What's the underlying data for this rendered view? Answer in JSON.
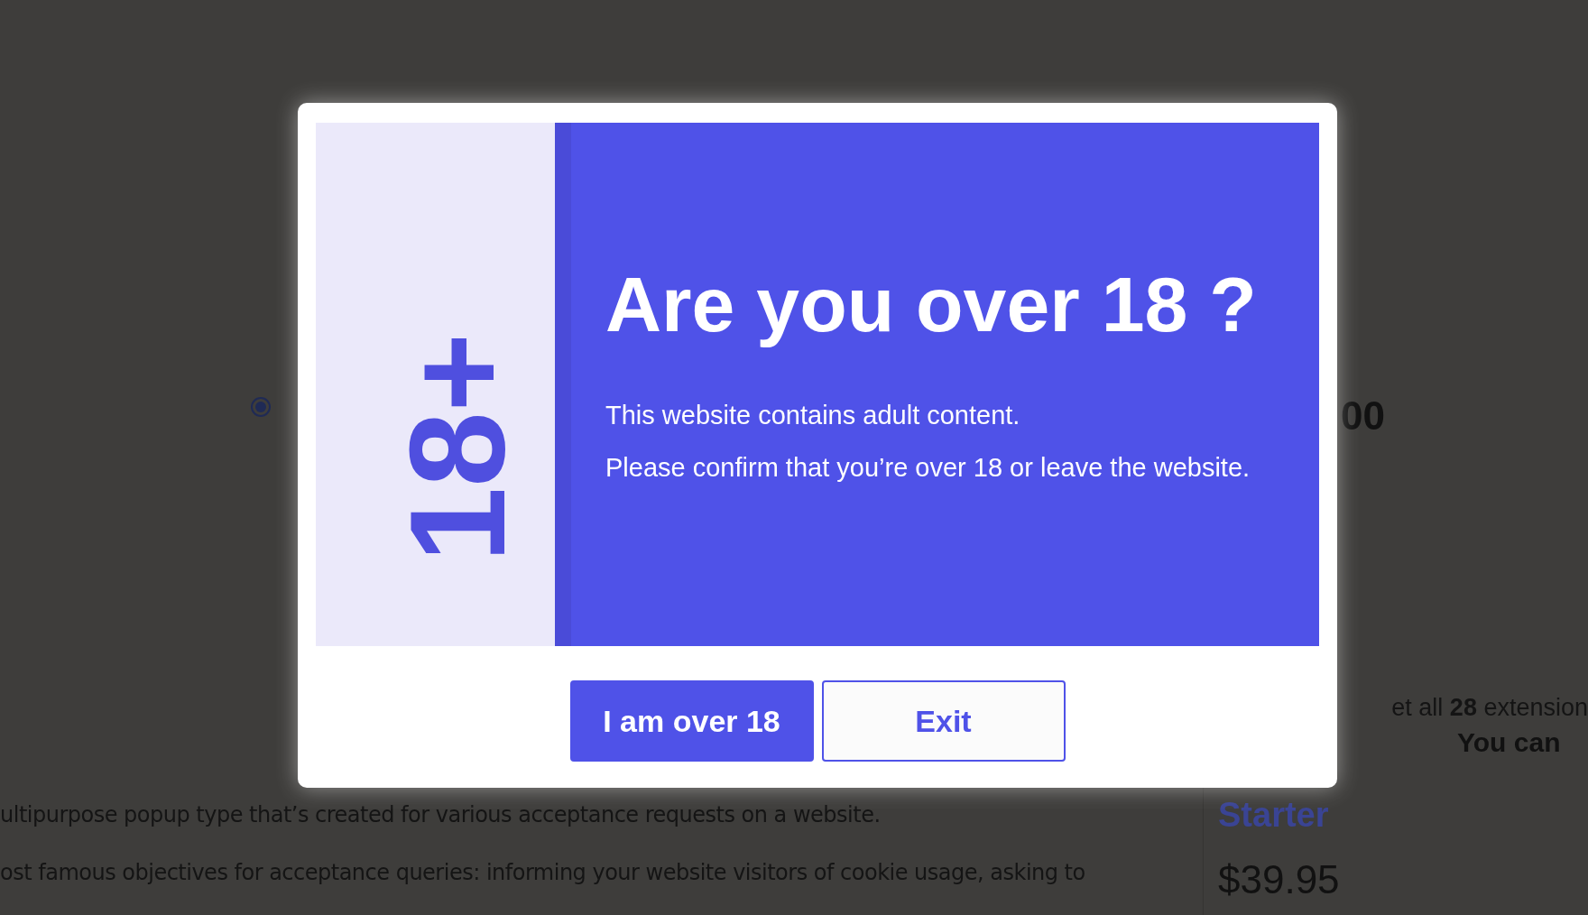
{
  "background": {
    "radio": {
      "selected": true
    },
    "price_partial": "00",
    "paragraphs": [
      "ultipurpose popup type that’s created for various acceptance requests on a website.",
      "ost famous objectives for acceptance queries: informing your website visitors of cookie usage, asking to"
    ],
    "extensions_note": "et all **28** extension",
    "extensions_sub": "You can",
    "plan": {
      "name": "Starter",
      "price": "$39.95"
    }
  },
  "modal": {
    "badge": "18+",
    "title": "Are you over 18 ?",
    "lines": [
      "This website contains adult content.",
      "Please confirm that you’re over 18 or leave the website."
    ],
    "buttons": [
      {
        "label": "I am over 18",
        "kind": "primary"
      },
      {
        "label": "Exit",
        "kind": "secondary"
      }
    ]
  }
}
